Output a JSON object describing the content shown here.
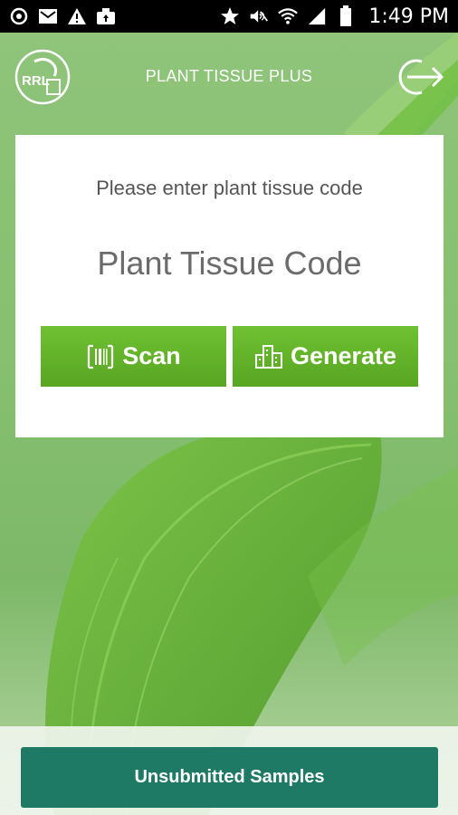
{
  "status_bar": {
    "time": "1:49 PM",
    "left_icons": [
      "sync-icon",
      "mail-icon",
      "warning-icon",
      "camera-upload-icon"
    ],
    "right_icons": [
      "star-icon",
      "mute-icon",
      "wifi-icon",
      "signal-icon",
      "battery-icon"
    ]
  },
  "header": {
    "title": "PLANT TISSUE PLUS",
    "logo_text": "RRL"
  },
  "card": {
    "prompt": "Please enter plant tissue code",
    "input_placeholder": "Plant Tissue Code",
    "input_value": "",
    "scan_label": "Scan",
    "generate_label": "Generate"
  },
  "footer": {
    "unsubmitted_label": "Unsubmitted Samples"
  },
  "colors": {
    "accent_green": "#5fb02a",
    "footer_button": "#1f7a65",
    "background_green": "#86c070"
  }
}
